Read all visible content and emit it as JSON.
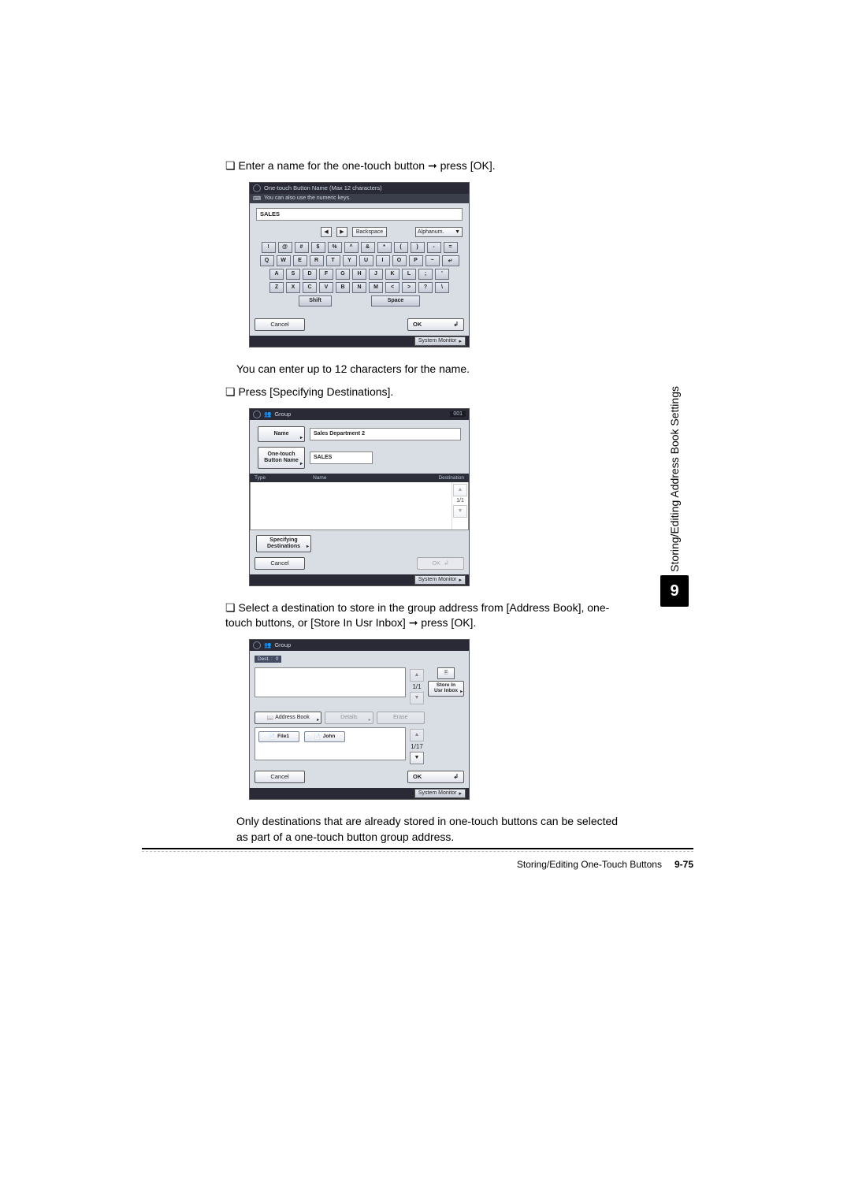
{
  "side": {
    "number": "9",
    "label": "Storing/Editing Address Book Settings"
  },
  "footer": {
    "section": "Storing/Editing One-Touch Buttons",
    "page": "9-75"
  },
  "step1": {
    "text_a": "Enter a name for the one-touch button ",
    "arrow": "➞",
    "text_b": " press [OK].",
    "note": "You can enter up to 12 characters for the name."
  },
  "ss1": {
    "title": "One-touch Button Name (Max 12 characters)",
    "info": "You can also use the numeric keys.",
    "input_value": "SALES",
    "nav_left": "◀",
    "nav_right": "▶",
    "backspace": "Backspace",
    "mode": "Alphanum.",
    "rows": [
      [
        "!",
        "@",
        "#",
        "$",
        "%",
        "^",
        "&",
        "*",
        "(",
        ")",
        "-",
        "="
      ],
      [
        "Q",
        "W",
        "E",
        "R",
        "T",
        "Y",
        "U",
        "I",
        "O",
        "P",
        "~",
        "↵"
      ],
      [
        "A",
        "S",
        "D",
        "F",
        "G",
        "H",
        "J",
        "K",
        "L",
        ";",
        "'"
      ],
      [
        "Z",
        "X",
        "C",
        "V",
        "B",
        "N",
        "M",
        "<",
        ">",
        "?",
        "\\"
      ]
    ],
    "shift": "Shift",
    "space": "Space",
    "cancel": "Cancel",
    "ok": "OK",
    "status": "System Monitor"
  },
  "step2": {
    "text": "Press [Specifying Destinations]."
  },
  "ss2": {
    "title": "Group",
    "id": "001",
    "name_btn": "Name",
    "name_val": "Sales Department 2",
    "ot_btn_l1": "One-touch",
    "ot_btn_l2": "Button Name",
    "ot_val": "SALES",
    "col_type": "Type",
    "col_name": "Name",
    "col_dest": "Destination",
    "page": "1/1",
    "spec": "Specifying\nDestinations",
    "cancel": "Cancel",
    "ok": "OK",
    "status": "System Monitor"
  },
  "step3": {
    "text_a": "Select a destination to store in the group address from [Address Book], one-touch buttons, or [Store In Usr Inbox] ",
    "arrow": "➞",
    "text_b": " press [OK].",
    "note": "Only destinations that are already stored in one-touch buttons can be selected as part of a one-touch button group address."
  },
  "ss3": {
    "title": "Group",
    "dest_lbl": "Dest. :",
    "dest_n": "0",
    "page_top": "1/1",
    "addr": "Address Book",
    "details": "Details",
    "erase": "Erase",
    "item1": "File1",
    "item2": "John",
    "page_bot": "1/17",
    "store": "Store In\nUsr Inbox",
    "cancel": "Cancel",
    "ok": "OK",
    "status": "System Monitor"
  }
}
